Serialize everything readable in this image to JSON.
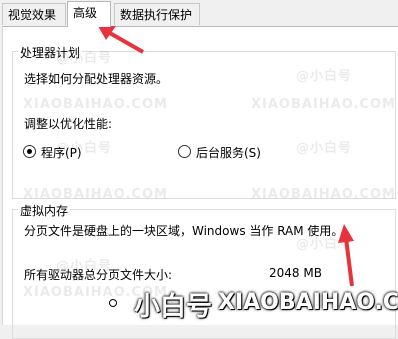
{
  "tabs": [
    {
      "label": "视觉效果",
      "active": false
    },
    {
      "label": "高级",
      "active": true
    },
    {
      "label": "数据执行保护",
      "active": false
    }
  ],
  "processor": {
    "title": "处理器计划",
    "description": "选择如何分配处理器资源。",
    "adjust_label": "调整以优化性能:",
    "options": [
      {
        "label": "程序(P)",
        "checked": true
      },
      {
        "label": "后台服务(S)",
        "checked": false
      }
    ]
  },
  "virtual_memory": {
    "title": "虚拟内存",
    "description": "分页文件是硬盘上的一块区域，Windows 当作 RAM 使用。",
    "total_label": "所有驱动器总分页文件大小:",
    "total_value": "2048 MB"
  },
  "watermark": {
    "brand": "小白号",
    "url": "XIAOBAIHAO.COM",
    "tile_text": "@小白号",
    "tile_url": "XIAOBAIHAO.COM"
  },
  "colors": {
    "annotation": "#e8323c",
    "panel_bg": "#ffffff",
    "window_bg": "#f0f0f0"
  }
}
